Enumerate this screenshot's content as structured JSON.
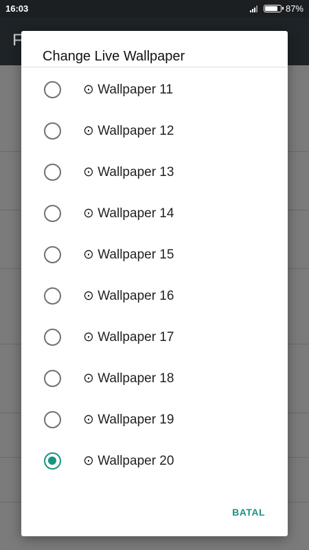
{
  "status_bar": {
    "time": "16:03",
    "battery": "87%",
    "battery_level": 0.87
  },
  "background_app": {
    "title_initial": "F"
  },
  "dialog": {
    "title": "Change Live Wallpaper",
    "options": [
      {
        "label": "⊙ Wallpaper 11",
        "checked": false
      },
      {
        "label": "⊙ Wallpaper 12",
        "checked": false
      },
      {
        "label": "⊙ Wallpaper 13",
        "checked": false
      },
      {
        "label": "⊙ Wallpaper 14",
        "checked": false
      },
      {
        "label": "⊙ Wallpaper 15",
        "checked": false
      },
      {
        "label": "⊙ Wallpaper 16",
        "checked": false
      },
      {
        "label": "⊙ Wallpaper 17",
        "checked": false
      },
      {
        "label": "⊙ Wallpaper 18",
        "checked": false
      },
      {
        "label": "⊙ Wallpaper 19",
        "checked": false
      },
      {
        "label": "⊙ Wallpaper 20",
        "checked": true
      }
    ],
    "cancel_label": "BATAL"
  },
  "colors": {
    "accent": "#19947f",
    "scrim": "#7b7b7b"
  }
}
